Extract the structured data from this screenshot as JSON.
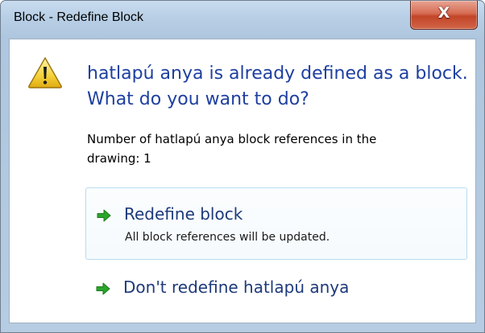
{
  "window": {
    "title": "Block - Redefine Block",
    "close_glyph": "X"
  },
  "dialog": {
    "icon": "warning-icon",
    "heading_line1": "hatlapú anya is already defined as a block.",
    "heading_line2": "What do you want to do?",
    "info_line1": "Number of hatlapú anya block references in the",
    "info_line2": "drawing: 1"
  },
  "options": [
    {
      "icon": "green-arrow-icon",
      "title": "Redefine block",
      "description": "All block references will be updated."
    },
    {
      "icon": "green-arrow-icon",
      "title": "Don't redefine hatlapú anya"
    }
  ],
  "colors": {
    "heading": "#1e3fa0",
    "option_title": "#1e3a7a",
    "arrow_green": "#2aa52a",
    "close_red": "#c24528",
    "frame_blue": "#b8cfe6",
    "option_highlight_border": "#b9dcee"
  }
}
